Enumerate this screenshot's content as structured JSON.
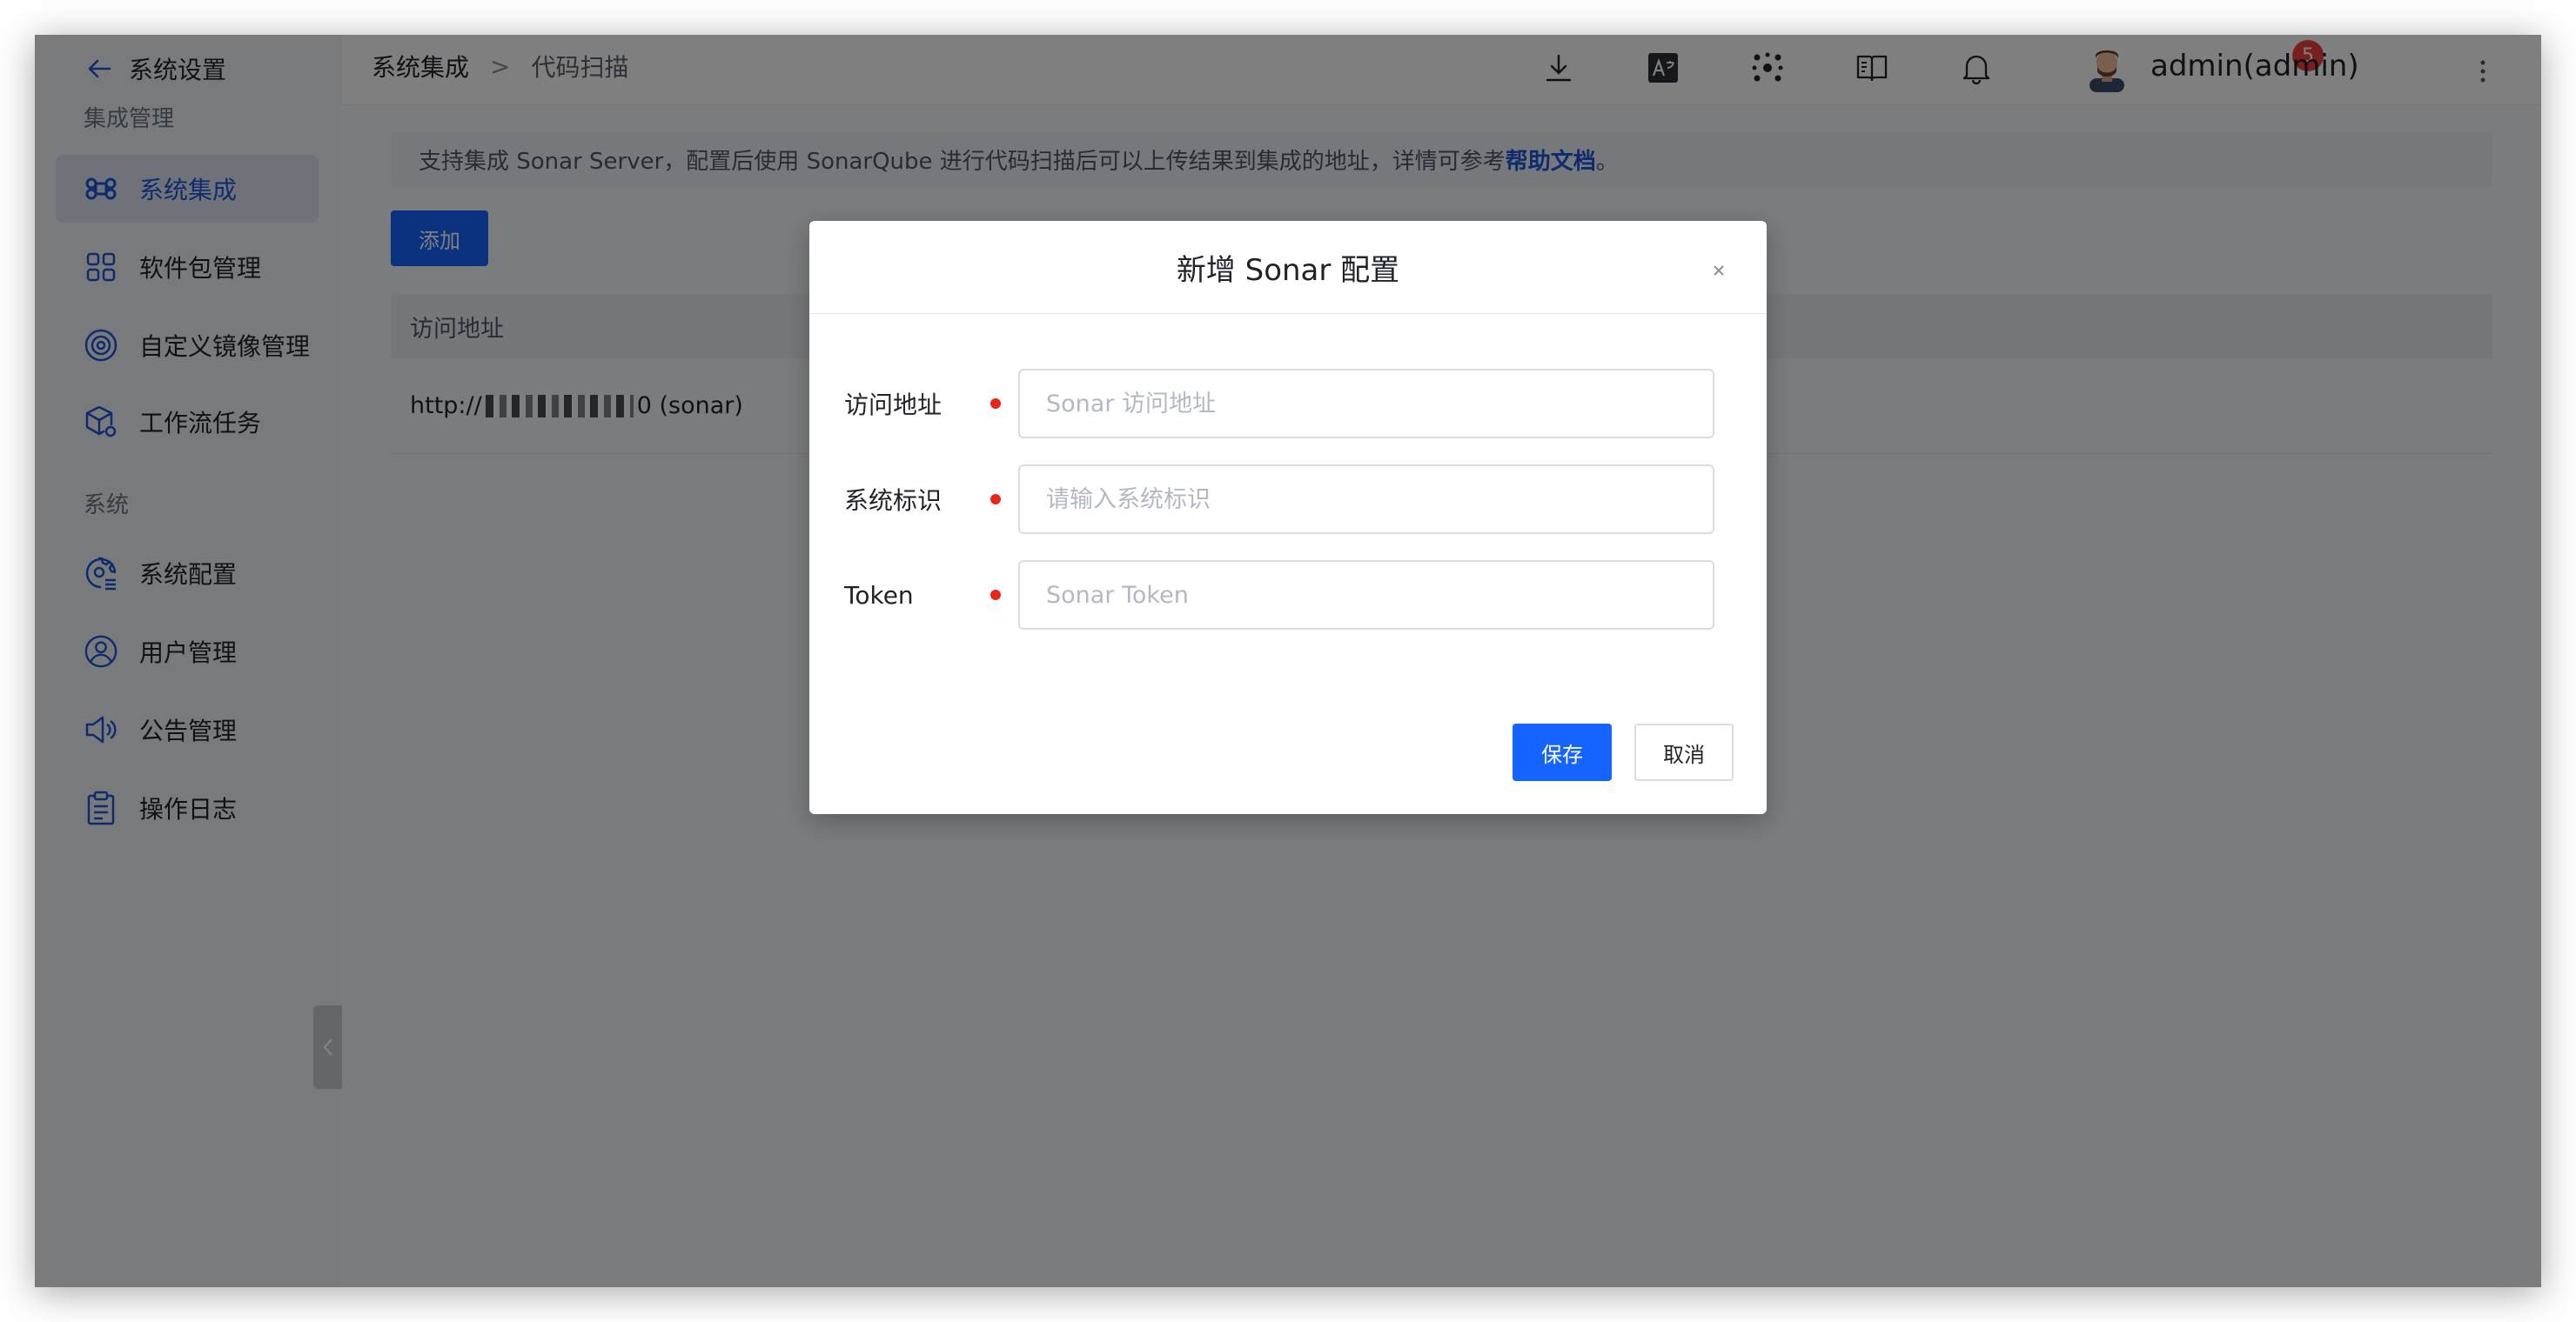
{
  "sidebar": {
    "back_label": "系统设置",
    "groups": [
      {
        "label": "集成管理"
      },
      {
        "label": "系统"
      }
    ],
    "items": [
      {
        "label": "系统集成",
        "icon": "command-icon",
        "active": true
      },
      {
        "label": "软件包管理",
        "icon": "apps-grid-icon"
      },
      {
        "label": "自定义镜像管理",
        "icon": "image-disc-icon"
      },
      {
        "label": "工作流任务",
        "icon": "workflow-cube-icon"
      },
      {
        "label": "系统配置",
        "icon": "settings-list-icon"
      },
      {
        "label": "用户管理",
        "icon": "user-icon"
      },
      {
        "label": "公告管理",
        "icon": "megaphone-icon"
      },
      {
        "label": "操作日志",
        "icon": "clipboard-icon"
      }
    ]
  },
  "header": {
    "breadcrumb": [
      "系统集成",
      ">",
      "代码扫描"
    ],
    "notification_count": "5",
    "user_name": "admin(admin)",
    "icons": [
      "download-icon",
      "translate-icon",
      "cluster-icon",
      "book-icon",
      "bell-icon",
      "more-icon"
    ]
  },
  "main": {
    "info_text": "支持集成 Sonar Server，配置后使用 SonarQube 进行代码扫描后可以上传结果到集成的地址，详情可参考 ",
    "info_link": "帮助文档",
    "info_end": "。",
    "add_label": "添加",
    "table": {
      "columns": [
        "访问地址"
      ],
      "rows": [
        {
          "url_prefix": "http://",
          "url_suffix": "0 (sonar)"
        }
      ]
    }
  },
  "modal": {
    "title": "新增 Sonar 配置",
    "fields": [
      {
        "label": "访问地址",
        "placeholder": "Sonar 访问地址",
        "value": "",
        "required": true
      },
      {
        "label": "系统标识",
        "placeholder": "请输入系统标识",
        "value": "",
        "required": true
      },
      {
        "label": "Token",
        "placeholder": "Sonar Token",
        "value": "",
        "required": true
      }
    ],
    "save_label": "保存",
    "cancel_label": "取消"
  },
  "colors": {
    "accent": "#1664ff",
    "link": "#1a56db",
    "required": "#e8261c",
    "badge": "#f03e3e"
  }
}
